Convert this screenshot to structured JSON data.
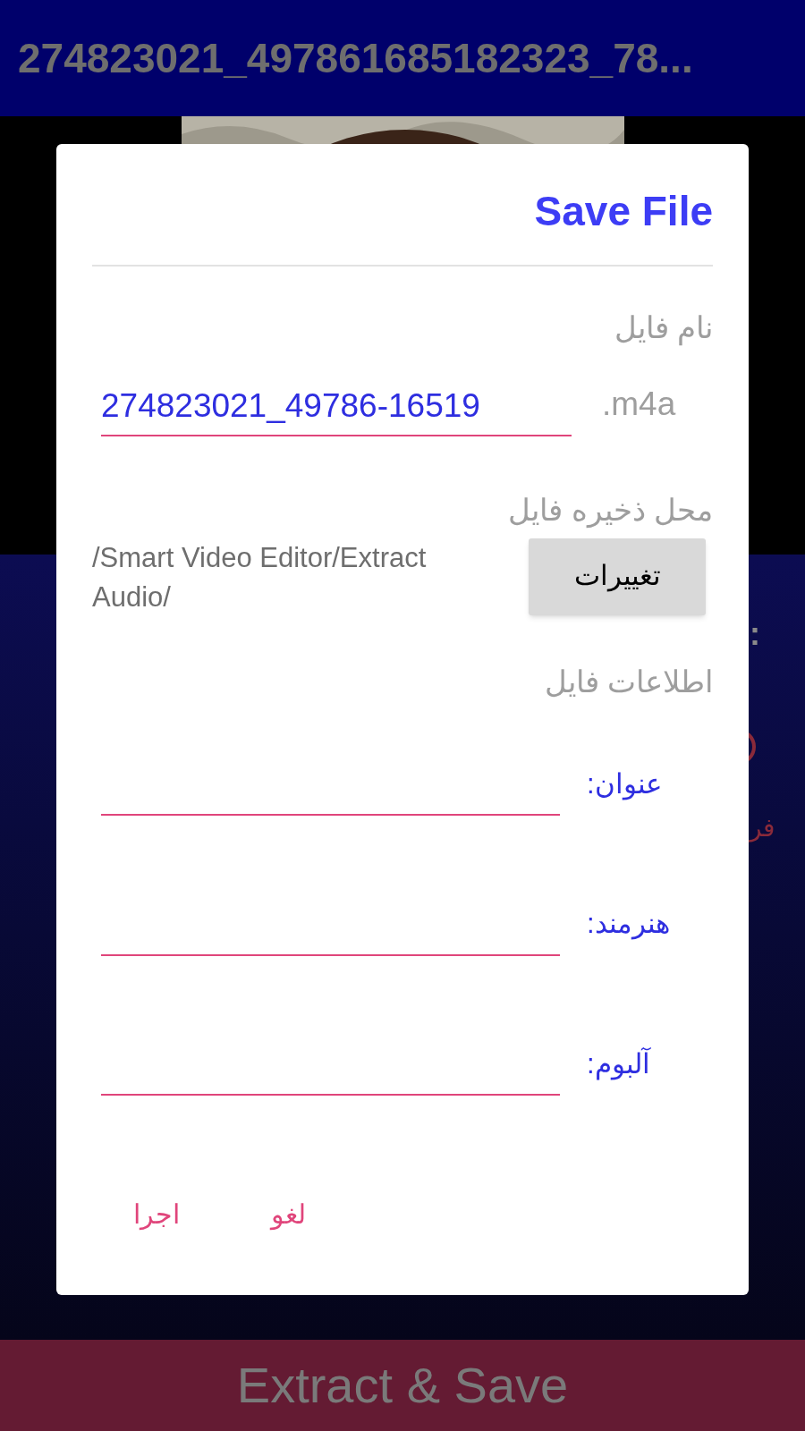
{
  "app_bar": {
    "title": "274823021_497861685182323_78..."
  },
  "background": {
    "side_mark": ":",
    "side_label": "فر",
    "action_button": "Extract & Save"
  },
  "dialog": {
    "title": "Save File",
    "file_name": {
      "label": "نام فایل",
      "value": "274823021_49786-16519",
      "extension": ".m4a"
    },
    "location": {
      "label": "محل ذخیره فایل",
      "path": "/Smart Video Editor/Extract Audio/",
      "change_button": "تغییرات"
    },
    "info": {
      "label": "اطلاعات فایل",
      "fields": [
        {
          "label": "عنوان:"
        },
        {
          "label": "هنرمند:"
        },
        {
          "label": "آلبوم:"
        }
      ]
    },
    "buttons": [
      "لغو",
      "اجرا"
    ]
  }
}
